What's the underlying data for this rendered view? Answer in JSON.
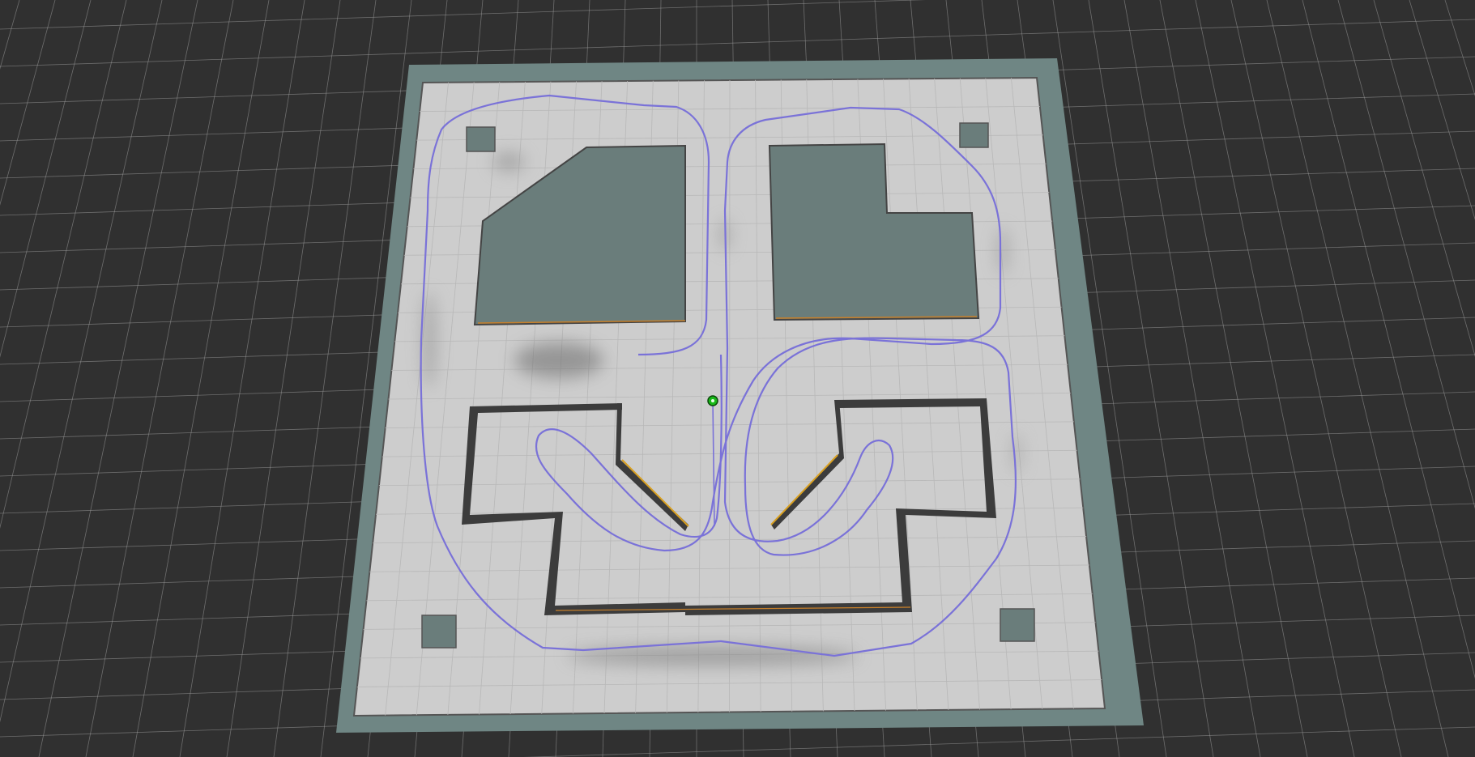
{
  "view": {
    "background_color": "#303030",
    "grid_color": "#a0a0a0",
    "map_border_color": "#6f8684",
    "map_floor_color": "#cdcdcd",
    "obstacle_fill_color": "#6a7d7b",
    "wall_color": "#3c3c3c",
    "wall_highlight_color": "#d9a020",
    "path_color": "#7a72d8",
    "robot_color": "#18b818"
  },
  "icons": {
    "robot": "robot-marker-icon"
  }
}
